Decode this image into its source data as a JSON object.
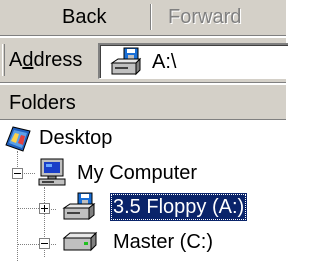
{
  "toolbar": {
    "back_label": "Back",
    "forward_label": "Forward"
  },
  "address": {
    "label_prefix": "A",
    "label_accel": "d",
    "label_suffix": "dress",
    "value": "A:\\"
  },
  "folders": {
    "title": "Folders"
  },
  "tree": {
    "desktop": "Desktop",
    "my_computer": "My Computer",
    "floppy": "3.5 Floppy (A:)",
    "master": "Master (C:)"
  },
  "colors": {
    "chrome": "#d4d0c8",
    "selection": "#0a246a",
    "disabled_text": "#808080"
  }
}
